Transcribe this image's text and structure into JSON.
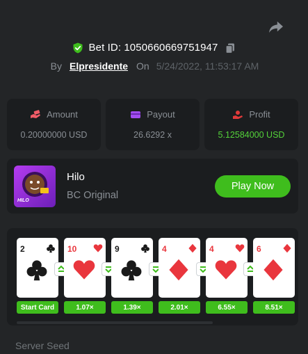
{
  "bet": {
    "id_label": "Bet ID: 1050660669751947",
    "by_label": "By",
    "username": "Elpresidente",
    "on_label": "On",
    "datetime": "5/24/2022, 11:53:17 AM"
  },
  "stats": {
    "amount": {
      "label": "Amount",
      "value": "0.20000000 USD",
      "icon": "money-hand-icon",
      "color": "#f15c68"
    },
    "payout": {
      "label": "Payout",
      "value": "26.6292 x",
      "icon": "card-icon",
      "color": "#a24cf1"
    },
    "profit": {
      "label": "Profit",
      "value": "5.12584000 USD",
      "icon": "coin-hand-icon",
      "color": "#e03a3a",
      "value_color": "#54d23a"
    }
  },
  "game": {
    "name": "Hilo",
    "subtitle": "BC Original",
    "thumb_label": "HILO",
    "play_label": "Play Now"
  },
  "cards": [
    {
      "rank": "2",
      "suit": "clubs",
      "color": "black",
      "multiplier": "Start Card"
    },
    {
      "rank": "10",
      "suit": "hearts",
      "color": "red",
      "multiplier": "1.07×",
      "guess": "higher"
    },
    {
      "rank": "9",
      "suit": "clubs",
      "color": "black",
      "multiplier": "1.39×",
      "guess": "lower"
    },
    {
      "rank": "4",
      "suit": "diamonds",
      "color": "red",
      "multiplier": "2.01×",
      "guess": "lower"
    },
    {
      "rank": "4",
      "suit": "hearts",
      "color": "red",
      "multiplier": "6.55×",
      "guess": "lower"
    },
    {
      "rank": "6",
      "suit": "diamonds",
      "color": "red",
      "multiplier": "8.51×",
      "guess": "higher"
    }
  ],
  "server_seed_label": "Server Seed",
  "colors": {
    "accent_green": "#3fbd1d",
    "background": "#232527",
    "panel": "#1b1d1f"
  }
}
